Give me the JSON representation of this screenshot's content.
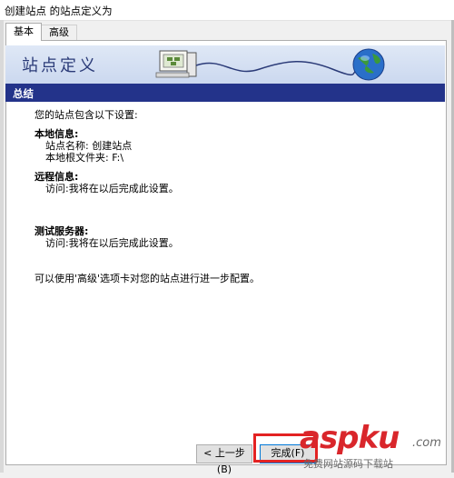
{
  "window": {
    "title": "创建站点 的站点定义为"
  },
  "tabs": [
    {
      "label": "基本"
    },
    {
      "label": "高级"
    }
  ],
  "banner": {
    "title": "站点定义"
  },
  "section": {
    "title": "总结"
  },
  "summary": {
    "intro": "您的站点包含以下设置:",
    "local": {
      "heading": "本地信息:",
      "site_name": "站点名称: 创建站点",
      "root_folder": "本地根文件夹: F:\\"
    },
    "remote": {
      "heading": "远程信息:",
      "access": "访问:我将在以后完成此设置。"
    },
    "testing": {
      "heading": "测试服务器:",
      "access": "访问:我将在以后完成此设置。"
    },
    "footer": "可以使用'高级'选项卡对您的站点进行进一步配置。"
  },
  "buttons": {
    "prev": "< 上一步(B)",
    "finish": "完成(F)"
  },
  "watermark": {
    "logo": "aspku",
    "tld": ".com",
    "sub": "免费网站源码下载站"
  },
  "colors": {
    "section_bar": "#23338a",
    "banner_bg": "#cbd8ef",
    "highlight": "#e32222",
    "watermark": "#d9262b"
  }
}
